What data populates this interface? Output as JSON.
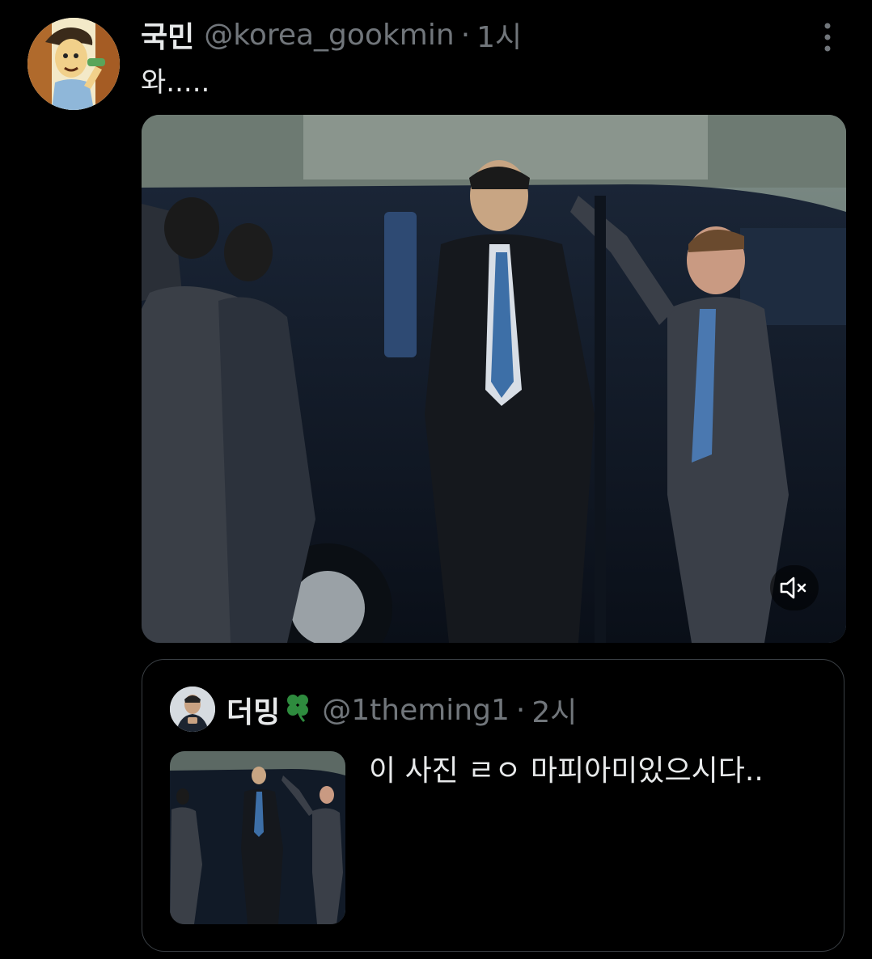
{
  "tweet": {
    "display_name": "국민",
    "handle": "@korea_gookmin",
    "separator": "·",
    "time": "1시",
    "text": "와.....",
    "avatar_icon": "cartoon-avatar",
    "more_icon": "more-vertical-icon",
    "media": {
      "kind": "video",
      "mute_icon": "volume-muted-icon"
    }
  },
  "quote": {
    "display_name": "더밍",
    "emoji": "🍀",
    "handle": "@1theming1",
    "separator": "·",
    "time": "2시",
    "text": "이 사진 ㄹㅇ 마피아미있으시다..",
    "avatar_icon": "profile-photo"
  },
  "colors": {
    "background": "#000000",
    "text_primary": "#e7e9ea",
    "text_secondary": "#71767b",
    "border": "#3a3f44"
  }
}
